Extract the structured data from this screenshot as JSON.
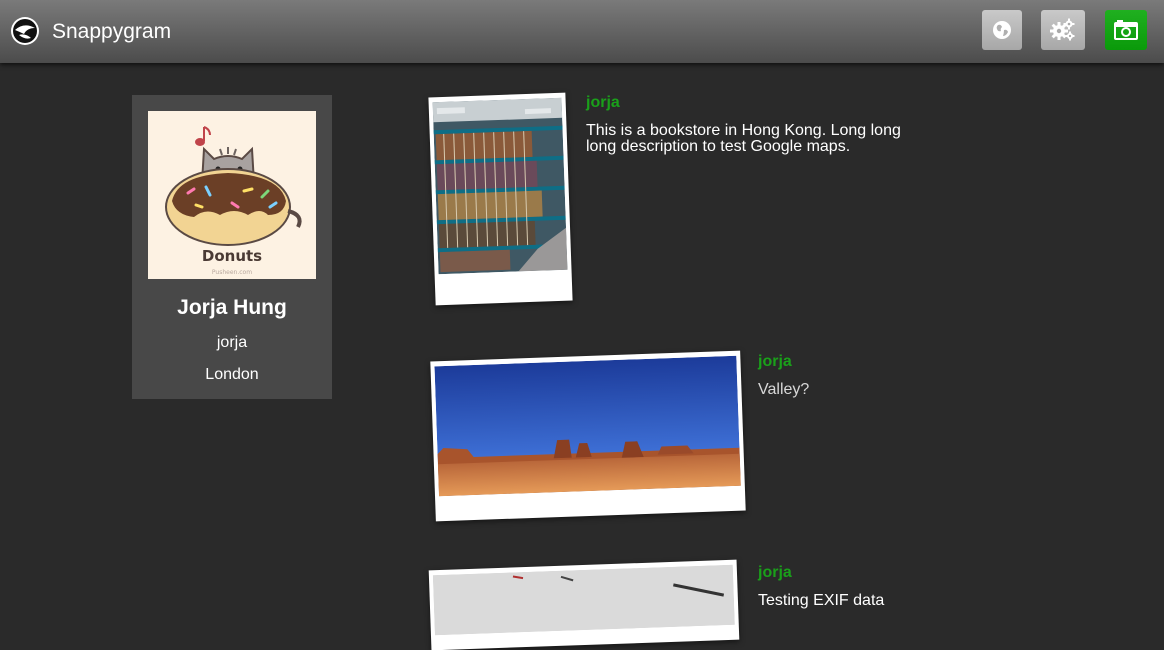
{
  "header": {
    "title": "Snappygram",
    "buttons": [
      {
        "icon": "globe-icon"
      },
      {
        "icon": "gear-icon"
      },
      {
        "icon": "camera-icon"
      }
    ],
    "accent": "#0a9a0a"
  },
  "profile": {
    "name": "Jorja Hung",
    "username": "jorja",
    "location": "London",
    "avatar_caption": "Donuts",
    "avatar_credit": "Pusheen.com"
  },
  "posts": [
    {
      "user": "jorja",
      "text": "This is a bookstore in Hong Kong. Long long long description to test Google maps.",
      "photo": "bookstore"
    },
    {
      "user": "jorja",
      "text": "Valley?",
      "photo": "desert-valley"
    },
    {
      "user": "jorja",
      "text": "Testing EXIF data",
      "photo": "desk-pens"
    }
  ]
}
